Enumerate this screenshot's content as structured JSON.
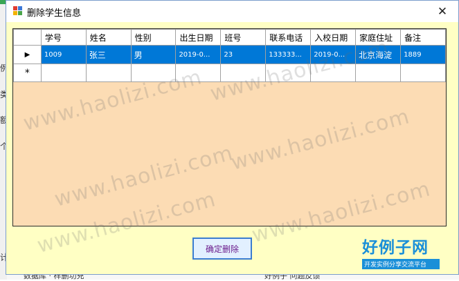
{
  "window": {
    "title": "删除学生信息",
    "close_glyph": "✕"
  },
  "grid": {
    "columns": [
      "学号",
      "姓名",
      "性别",
      "出生日期",
      "班号",
      "联系电话",
      "入校日期",
      "家庭住址",
      "备注"
    ],
    "rows": [
      {
        "indicator": "▶",
        "cells": [
          "1009",
          "张三",
          "男",
          "2019-0...",
          "23",
          "133333...",
          "2019-0...",
          "北京海淀",
          "1889"
        ]
      }
    ],
    "new_row_indicator": "*"
  },
  "buttons": {
    "confirm_label": "确定删除"
  },
  "watermark": "www.haolizi.com",
  "logo": {
    "main": "好例子网",
    "sub": "开发实例分享交流平台"
  },
  "background": {
    "left_chars": [
      "例",
      "类",
      "额",
      "个",
      "计"
    ],
    "bottom_left": "数据库 · 样删功充",
    "bottom_right": "好例子 问题反馈"
  },
  "colors": {
    "selection": "#0078d7",
    "form_bg": "#ffffc4",
    "grid_bg": "#fcdcb4",
    "accent": "#1a8fd8"
  }
}
